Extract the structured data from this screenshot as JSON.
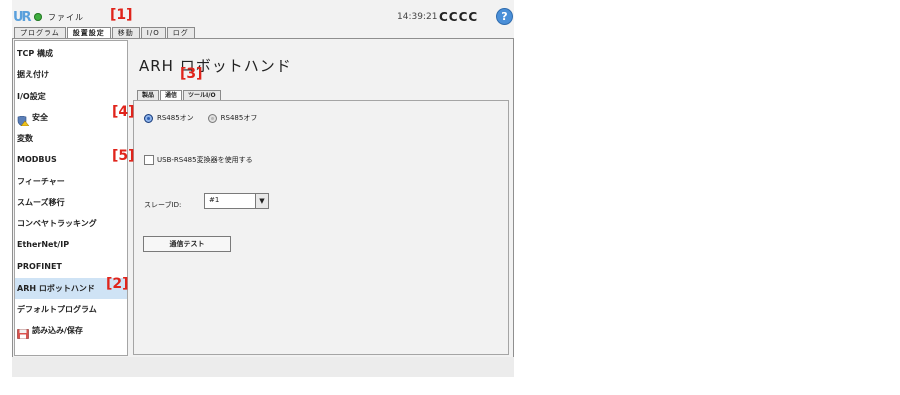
{
  "header": {
    "logo": "UR",
    "file_menu": "ファイル",
    "time": "14:39:21",
    "robot_name": "CCCC",
    "help_label": "?"
  },
  "main_tabs": [
    {
      "label": "プログラム",
      "active": false
    },
    {
      "label": "設置設定",
      "active": true
    },
    {
      "label": "移動",
      "active": false
    },
    {
      "label": "I/O",
      "active": false
    },
    {
      "label": "ログ",
      "active": false
    }
  ],
  "sidebar": {
    "items": [
      {
        "label": "TCP 構成",
        "icon": ""
      },
      {
        "label": "据え付け",
        "icon": ""
      },
      {
        "label": "I/O設定",
        "icon": ""
      },
      {
        "label": "安全",
        "icon": "shield-warning-icon"
      },
      {
        "label": "変数",
        "icon": ""
      },
      {
        "label": "MODBUS",
        "icon": ""
      },
      {
        "label": "フィーチャー",
        "icon": ""
      },
      {
        "label": "スムーズ移行",
        "icon": ""
      },
      {
        "label": "コンベヤトラッキング",
        "icon": ""
      },
      {
        "label": "EtherNet/IP",
        "icon": ""
      },
      {
        "label": "PROFINET",
        "icon": ""
      },
      {
        "label": "ARH ロボットハンド",
        "icon": "",
        "active": true
      },
      {
        "label": "デフォルトプログラム",
        "icon": ""
      },
      {
        "label": "読み込み/保存",
        "icon": "save-icon"
      }
    ]
  },
  "content": {
    "title": "ARH ロボットハンド",
    "tabs": [
      {
        "label": "製品",
        "active": false
      },
      {
        "label": "通信",
        "active": true
      },
      {
        "label": "ツールI/O",
        "active": false
      }
    ],
    "rs485_on": "RS485オン",
    "rs485_off": "RS485オフ",
    "usb_checkbox": "USB-RS485変換器を使用する",
    "slave_label": "スレーブID:",
    "slave_value": "#1",
    "test_button": "通信テスト"
  },
  "annotations": [
    "[1]",
    "[2]",
    "[3]",
    "[4]",
    "[5]"
  ],
  "colors": {
    "accent": "#2d5fb4",
    "selected": "#cfe3f5",
    "annotation": "#e0241b"
  }
}
